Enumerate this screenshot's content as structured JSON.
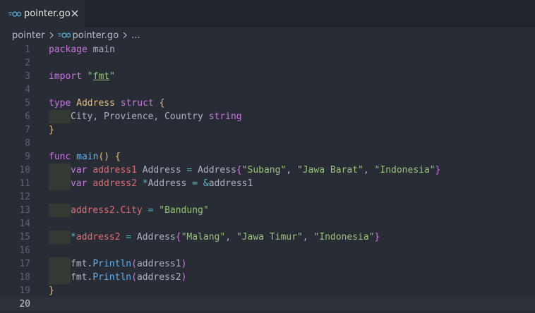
{
  "tab": {
    "label": "pointer.go",
    "icon": "go-icon"
  },
  "breadcrumb": {
    "folder": "pointer",
    "file": "pointer.go",
    "more": "..."
  },
  "editor": {
    "language": "go",
    "current_line": 20,
    "lines": [
      {
        "n": "1",
        "tokens": [
          {
            "t": "package",
            "c": "kw"
          },
          {
            "t": " main",
            "c": "pl"
          }
        ]
      },
      {
        "n": "2",
        "tokens": []
      },
      {
        "n": "3",
        "tokens": [
          {
            "t": "import",
            "c": "kw"
          },
          {
            "t": " ",
            "c": "pl"
          },
          {
            "t": "\"",
            "c": "str"
          },
          {
            "t": "fmt",
            "c": "fmtpkg"
          },
          {
            "t": "\"",
            "c": "str"
          }
        ]
      },
      {
        "n": "4",
        "tokens": []
      },
      {
        "n": "5",
        "tokens": [
          {
            "t": "type",
            "c": "kw"
          },
          {
            "t": " ",
            "c": "pl"
          },
          {
            "t": "Address",
            "c": "ty"
          },
          {
            "t": " ",
            "c": "pl"
          },
          {
            "t": "struct",
            "c": "kw"
          },
          {
            "t": " ",
            "c": "pl"
          },
          {
            "t": "{",
            "c": "br1"
          }
        ]
      },
      {
        "n": "6",
        "indent": 1,
        "tokens": [
          {
            "t": "City, Provience, Country ",
            "c": "pl"
          },
          {
            "t": "string",
            "c": "kw"
          }
        ]
      },
      {
        "n": "7",
        "tokens": [
          {
            "t": "}",
            "c": "br1"
          }
        ]
      },
      {
        "n": "8",
        "tokens": []
      },
      {
        "n": "9",
        "tokens": [
          {
            "t": "func",
            "c": "kw"
          },
          {
            "t": " ",
            "c": "pl"
          },
          {
            "t": "main",
            "c": "fn"
          },
          {
            "t": "()",
            "c": "br1"
          },
          {
            "t": " ",
            "c": "pl"
          },
          {
            "t": "{",
            "c": "br1"
          }
        ]
      },
      {
        "n": "10",
        "indent": 1,
        "tokens": [
          {
            "t": "var",
            "c": "kw"
          },
          {
            "t": " ",
            "c": "pl"
          },
          {
            "t": "address1",
            "c": "var"
          },
          {
            "t": " Address ",
            "c": "pl"
          },
          {
            "t": "=",
            "c": "op"
          },
          {
            "t": " Address",
            "c": "pl"
          },
          {
            "t": "{",
            "c": "br2"
          },
          {
            "t": "\"Subang\"",
            "c": "str"
          },
          {
            "t": ", ",
            "c": "pl"
          },
          {
            "t": "\"Jawa Barat\"",
            "c": "str"
          },
          {
            "t": ", ",
            "c": "pl"
          },
          {
            "t": "\"Indonesia\"",
            "c": "str"
          },
          {
            "t": "}",
            "c": "br2"
          }
        ]
      },
      {
        "n": "11",
        "indent": 1,
        "tokens": [
          {
            "t": "var",
            "c": "kw"
          },
          {
            "t": " ",
            "c": "pl"
          },
          {
            "t": "address2",
            "c": "var"
          },
          {
            "t": " ",
            "c": "pl"
          },
          {
            "t": "*",
            "c": "op"
          },
          {
            "t": "Address ",
            "c": "pl"
          },
          {
            "t": "=",
            "c": "op"
          },
          {
            "t": " ",
            "c": "pl"
          },
          {
            "t": "&",
            "c": "op"
          },
          {
            "t": "address1",
            "c": "pl"
          }
        ]
      },
      {
        "n": "12",
        "tokens": []
      },
      {
        "n": "13",
        "indent": 1,
        "tokens": [
          {
            "t": "address2",
            "c": "var"
          },
          {
            "t": ".City ",
            "c": "var"
          },
          {
            "t": "=",
            "c": "op"
          },
          {
            "t": " ",
            "c": "pl"
          },
          {
            "t": "\"Bandung\"",
            "c": "str"
          }
        ]
      },
      {
        "n": "14",
        "tokens": []
      },
      {
        "n": "15",
        "indent": 1,
        "tokens": [
          {
            "t": "*",
            "c": "op"
          },
          {
            "t": "address2",
            "c": "var"
          },
          {
            "t": " ",
            "c": "pl"
          },
          {
            "t": "=",
            "c": "op"
          },
          {
            "t": " Address",
            "c": "pl"
          },
          {
            "t": "{",
            "c": "br2"
          },
          {
            "t": "\"Malang\"",
            "c": "str"
          },
          {
            "t": ", ",
            "c": "pl"
          },
          {
            "t": "\"Jawa Timur\"",
            "c": "str"
          },
          {
            "t": ", ",
            "c": "pl"
          },
          {
            "t": "\"Indonesia\"",
            "c": "str"
          },
          {
            "t": "}",
            "c": "br2"
          }
        ]
      },
      {
        "n": "16",
        "tokens": []
      },
      {
        "n": "17",
        "indent": 1,
        "tokens": [
          {
            "t": "fmt.",
            "c": "pl"
          },
          {
            "t": "Println",
            "c": "fn"
          },
          {
            "t": "(",
            "c": "br2"
          },
          {
            "t": "address1",
            "c": "pl"
          },
          {
            "t": ")",
            "c": "br2"
          }
        ]
      },
      {
        "n": "18",
        "indent": 1,
        "tokens": [
          {
            "t": "fmt.",
            "c": "pl"
          },
          {
            "t": "Println",
            "c": "fn"
          },
          {
            "t": "(",
            "c": "br2"
          },
          {
            "t": "address2",
            "c": "pl"
          },
          {
            "t": ")",
            "c": "br2"
          }
        ]
      },
      {
        "n": "19",
        "tokens": [
          {
            "t": "}",
            "c": "br1"
          }
        ]
      },
      {
        "n": "20",
        "tokens": []
      }
    ]
  }
}
